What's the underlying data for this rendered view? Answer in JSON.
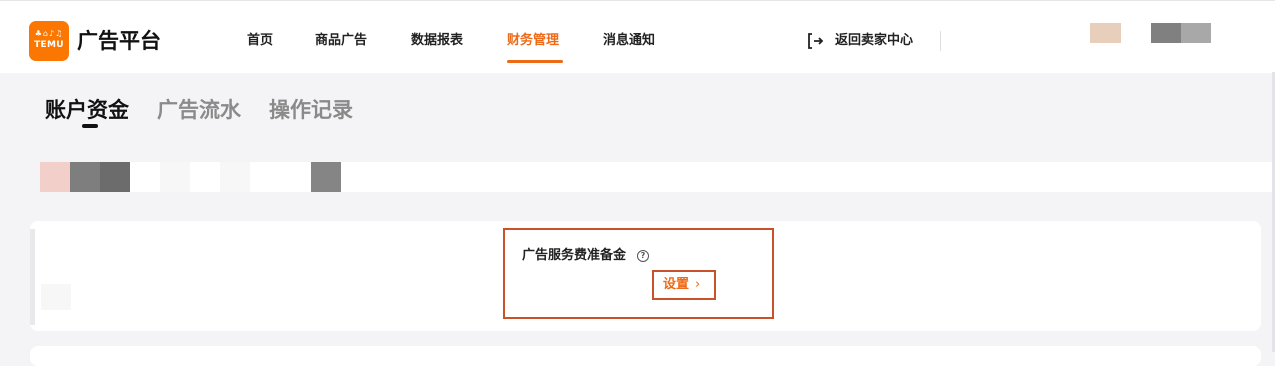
{
  "header": {
    "logo": {
      "glyphs": "♣⌂♪♫",
      "text": "TEMU"
    },
    "platform_name": "广告平台",
    "nav_items": [
      {
        "label": "首页",
        "active": false
      },
      {
        "label": "商品广告",
        "active": false
      },
      {
        "label": "数据报表",
        "active": false
      },
      {
        "label": "财务管理",
        "active": true
      },
      {
        "label": "消息通知",
        "active": false
      }
    ],
    "back_to_seller_center": "返回卖家中心"
  },
  "tabs": [
    {
      "label": "账户资金",
      "active": true
    },
    {
      "label": "广告流水",
      "active": false
    },
    {
      "label": "操作记录",
      "active": false
    }
  ],
  "reserve": {
    "label": "广告服务费准备金",
    "help_icon": "question-circle-icon",
    "set_button_label": "设置",
    "set_button_icon": "chevron-right-icon"
  },
  "colors": {
    "accent": "#ee6a17",
    "logo_bg": "#fb7701",
    "highlight_border": "#c8532a",
    "page_bg": "#f4f4f6"
  }
}
